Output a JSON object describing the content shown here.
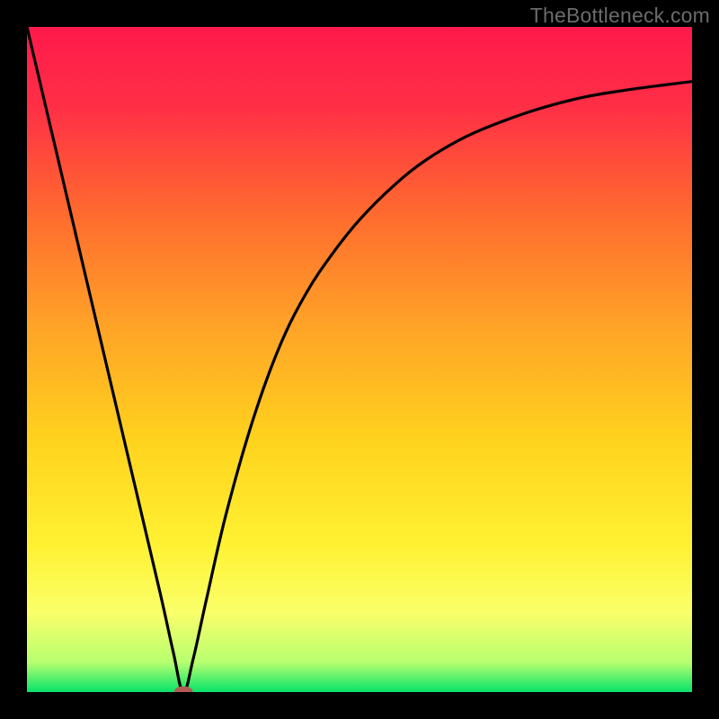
{
  "watermark": {
    "text": "TheBottleneck.com"
  },
  "chart_data": {
    "type": "line",
    "title": "",
    "xlabel": "",
    "ylabel": "",
    "xlim": [
      0,
      100
    ],
    "ylim": [
      0,
      100
    ],
    "grid": false,
    "legend": false,
    "background_gradient": {
      "stops": [
        {
          "offset": 0.0,
          "color": "#ff1a4b"
        },
        {
          "offset": 0.12,
          "color": "#ff2f46"
        },
        {
          "offset": 0.28,
          "color": "#ff6a2f"
        },
        {
          "offset": 0.45,
          "color": "#ffa327"
        },
        {
          "offset": 0.62,
          "color": "#ffd21e"
        },
        {
          "offset": 0.78,
          "color": "#fff232"
        },
        {
          "offset": 0.88,
          "color": "#faff6a"
        },
        {
          "offset": 0.955,
          "color": "#b8ff6f"
        },
        {
          "offset": 1.0,
          "color": "#07e36a"
        }
      ]
    },
    "series": [
      {
        "name": "bottleneck-curve",
        "color": "#000000",
        "x": [
          0,
          4,
          8,
          12,
          16,
          20,
          22,
          23.5,
          25,
          27,
          30,
          34,
          38,
          42,
          46,
          50,
          55,
          60,
          66,
          72,
          78,
          84,
          90,
          96,
          100
        ],
        "y": [
          100,
          83,
          66,
          49,
          32,
          15,
          6,
          0,
          5,
          14,
          27,
          41,
          52,
          60,
          66,
          71,
          76,
          80,
          83.5,
          86,
          88,
          89.5,
          90.5,
          91.3,
          91.8
        ]
      }
    ],
    "marker": {
      "name": "optimal-point",
      "x": 23.5,
      "y": 0,
      "color": "#b35a56",
      "width_pct": 2.8,
      "height_pct": 1.7
    }
  }
}
